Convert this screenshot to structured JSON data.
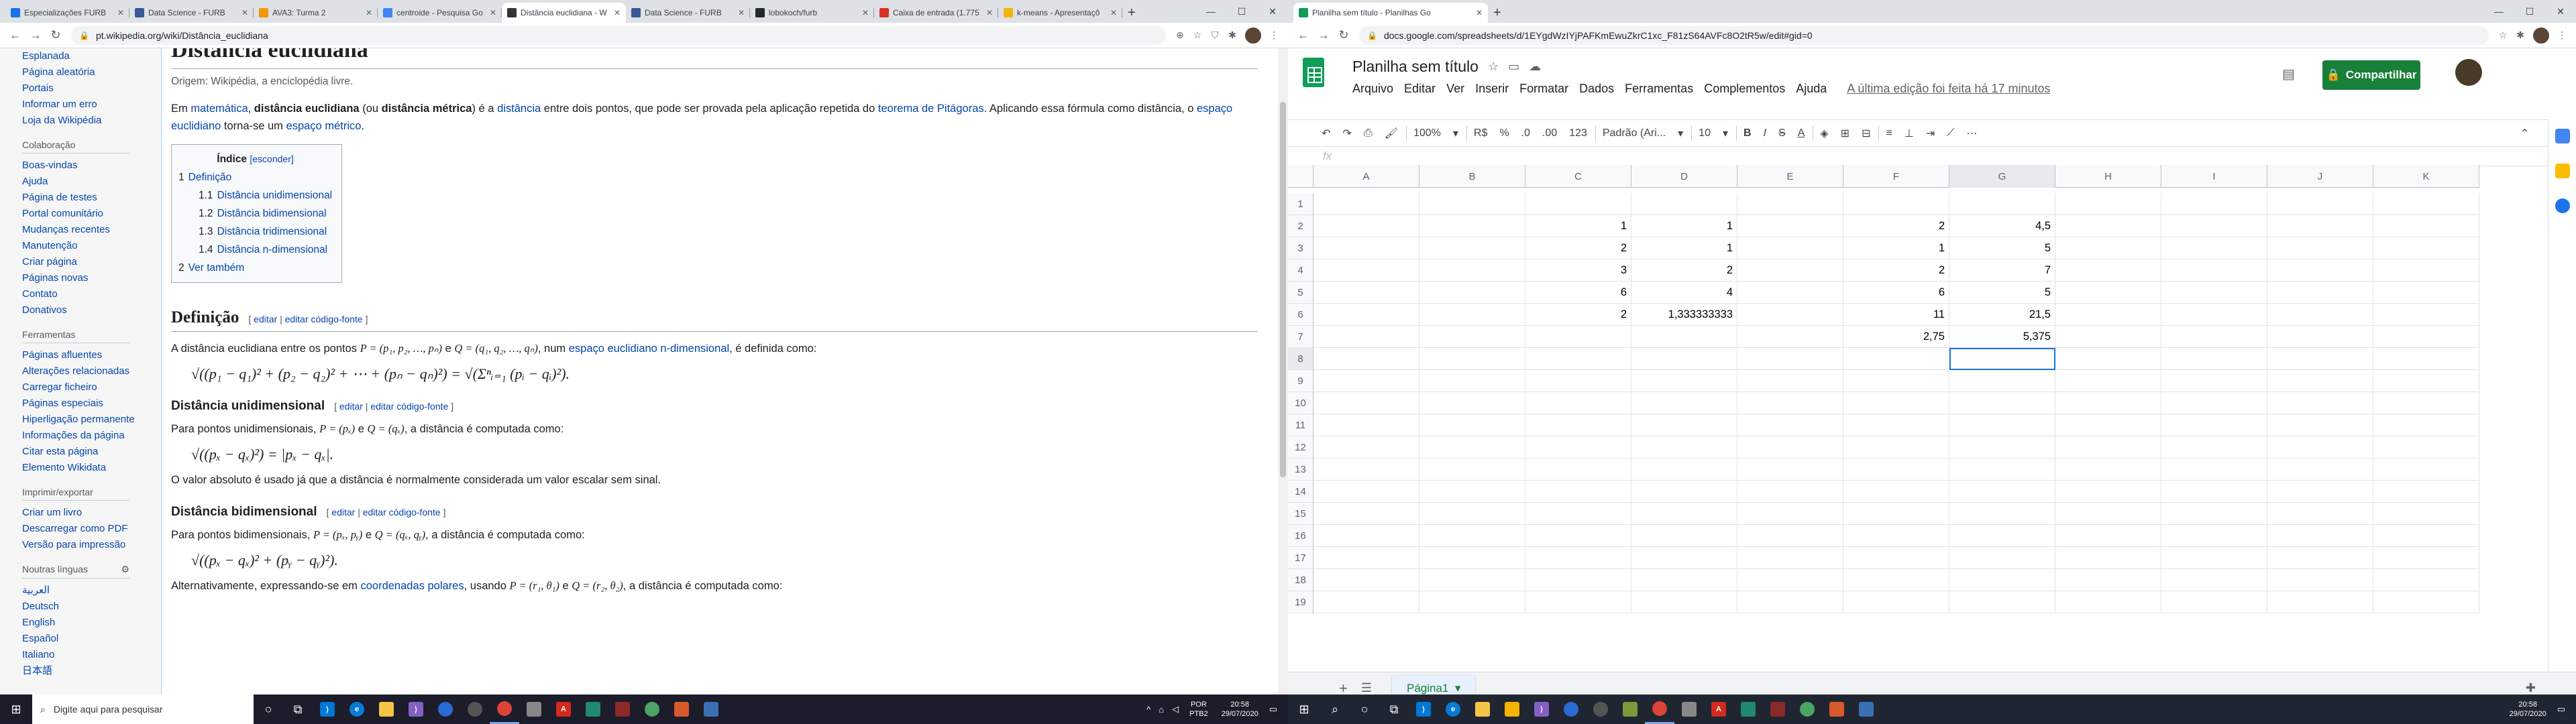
{
  "left": {
    "tabs": [
      {
        "title": "Especializações FURB",
        "color": "#1a73e8"
      },
      {
        "title": "Data Science - FURB",
        "color": "#3b5998"
      },
      {
        "title": "AVA3: Turma 2",
        "color": "#f29900"
      },
      {
        "title": "centroide - Pesquisa Go",
        "color": "#4285f4"
      },
      {
        "title": "Distância euclidiana - W",
        "color": "#333333",
        "active": true
      },
      {
        "title": "Data Science - FURB",
        "color": "#3b5998"
      },
      {
        "title": "lobokoch/furb",
        "color": "#24292e"
      },
      {
        "title": "Caixa de entrada (1.775",
        "color": "#d93025"
      },
      {
        "title": "k-means - Apresentaçõ",
        "color": "#f4b400"
      }
    ],
    "url": "pt.wikipedia.org/wiki/Distância_euclidiana",
    "sidebar": {
      "top_links": [
        "Esplanada",
        "Página aleatória",
        "Portais",
        "Informar um erro",
        "Loja da Wikipédia"
      ],
      "sections": [
        {
          "title": "Colaboração",
          "links": [
            "Boas-vindas",
            "Ajuda",
            "Página de testes",
            "Portal comunitário",
            "Mudanças recentes",
            "Manutenção",
            "Criar página",
            "Páginas novas",
            "Contato",
            "Donativos"
          ]
        },
        {
          "title": "Ferramentas",
          "links": [
            "Páginas afluentes",
            "Alterações relacionadas",
            "Carregar ficheiro",
            "Páginas especiais",
            "Hiperligação permanente",
            "Informações da página",
            "Citar esta página",
            "Elemento Wikidata"
          ]
        },
        {
          "title": "Imprimir/exportar",
          "links": [
            "Criar um livro",
            "Descarregar como PDF",
            "Versão para impressão"
          ]
        },
        {
          "title": "Noutras línguas",
          "links": [
            "العربية",
            "Deutsch",
            "English",
            "Español",
            "Italiano",
            "日本語"
          ]
        }
      ]
    },
    "article": {
      "title": "Distância euclidiana",
      "origin": "Origem: Wikipédia, a enciclopédia livre.",
      "intro": {
        "a1": "Em ",
        "l1": "matemática",
        "a2": ", ",
        "b1": "distância euclidiana",
        "a3": " (ou ",
        "b2": "distância métrica",
        "a4": ") é a ",
        "l2": "distância",
        "a5": " entre dois pontos, que pode ser provada pela aplicação repetida do ",
        "l3": "teorema de Pitágoras",
        "a6": ". Aplicando essa fórmula como distância, o ",
        "l4": "espaço euclidiano",
        "a7": " torna-se um ",
        "l5": "espaço métrico",
        "a8": "."
      },
      "toc": {
        "title": "Índice",
        "toggle": "[esconder]",
        "items": [
          {
            "num": "1",
            "label": "Definição",
            "level": 1
          },
          {
            "num": "1.1",
            "label": "Distância unidimensional",
            "level": 2
          },
          {
            "num": "1.2",
            "label": "Distância bidimensional",
            "level": 2
          },
          {
            "num": "1.3",
            "label": "Distância tridimensional",
            "level": 2
          },
          {
            "num": "1.4",
            "label": "Distância n-dimensional",
            "level": 2
          },
          {
            "num": "2",
            "label": "Ver também",
            "level": 1
          }
        ]
      },
      "edit_links": {
        "open": "[ ",
        "edit": "editar",
        "sep": " | ",
        "edit_source": "editar código-fonte",
        "close": " ]"
      },
      "definition": {
        "heading": "Definição",
        "text1": "A distância euclidiana entre os pontos ",
        "p": "P = (p₁, p₂, …, pₙ)",
        "and": " e ",
        "q": "Q = (q₁, q₂, …, qₙ)",
        "text2": ", num ",
        "link": "espaço euclidiano n-dimensional",
        "text3": ", é definida como:",
        "formula": "√((p₁ − q₁)² + (p₂ − q₂)² + ⋯ + (pₙ − qₙ)²) = √(Σⁿᵢ₌₁ (pᵢ − qᵢ)²)."
      },
      "uni": {
        "heading": "Distância unidimensional",
        "text1": "Para pontos unidimensionais, ",
        "p": "P = (pₓ)",
        "and": " e ",
        "q": "Q = (qₓ)",
        "text2": ", a distância é computada como:",
        "formula": "√((pₓ − qₓ)²) = |pₓ − qₓ|.",
        "note": "O valor absoluto é usado já que a distância é normalmente considerada um valor escalar sem sinal."
      },
      "bi": {
        "heading": "Distância bidimensional",
        "text1": "Para pontos bidimensionais, ",
        "p": "P = (pₓ, pᵧ)",
        "and": " e ",
        "q": "Q = (qₓ, qᵧ)",
        "text2": ", a distância é computada como:",
        "formula": "√((pₓ − qₓ)² + (pᵧ − qᵧ)²).",
        "alt1": "Alternativamente, expressando-se em ",
        "alt_link": "coordenadas polares",
        "alt2": ", usando ",
        "alt_p": "P = (r₁, θ₁)",
        "alt_and": " e ",
        "alt_q": "Q = (r₂, θ₂)",
        "alt3": ", a distância é computada como:"
      }
    },
    "taskbar": {
      "search_placeholder": "Digite aqui para pesquisar",
      "lang": "POR",
      "lang2": "PTB2",
      "time": "20:58",
      "date": "29/07/2020"
    }
  },
  "right": {
    "tabs": [
      {
        "title": "Planilha sem título - Planilhas Go",
        "color": "#0f9d58",
        "active": true
      }
    ],
    "url": "docs.google.com/spreadsheets/d/1EYgdWzIYjPAFKmEwuZkrC1xc_F81zS64AVFc8O2tR5w/edit#gid=0",
    "doc_title": "Planilha sem título",
    "menu": [
      "Arquivo",
      "Editar",
      "Ver",
      "Inserir",
      "Formatar",
      "Dados",
      "Ferramentas",
      "Complementos",
      "Ajuda"
    ],
    "last_edit": "A última edição foi feita há 17 minutos",
    "share_label": "Compartilhar",
    "toolbar": {
      "zoom": "100%",
      "currency": "R$",
      "percent": "%",
      "dec_less": ".0",
      "dec_more": ".00",
      "format": "123",
      "font": "Padrão (Ari...",
      "size": "10"
    },
    "fx": "fx",
    "columns": [
      "A",
      "B",
      "C",
      "D",
      "E",
      "F",
      "G",
      "H",
      "I",
      "J",
      "K"
    ],
    "rows": [
      [
        "",
        "",
        "",
        "",
        "",
        "",
        "",
        "",
        "",
        "",
        ""
      ],
      [
        "",
        "",
        "1",
        "1",
        "",
        "2",
        "4,5",
        "",
        "",
        "",
        ""
      ],
      [
        "",
        "",
        "2",
        "1",
        "",
        "1",
        "5",
        "",
        "",
        "",
        ""
      ],
      [
        "",
        "",
        "3",
        "2",
        "",
        "2",
        "7",
        "",
        "",
        "",
        ""
      ],
      [
        "",
        "",
        "6",
        "4",
        "",
        "6",
        "5",
        "",
        "",
        "",
        ""
      ],
      [
        "",
        "",
        "2",
        "1,333333333",
        "",
        "11",
        "21,5",
        "",
        "",
        "",
        ""
      ],
      [
        "",
        "",
        "",
        "",
        "",
        "2,75",
        "5,375",
        "",
        "",
        "",
        ""
      ],
      [
        "",
        "",
        "",
        "",
        "",
        "",
        "",
        "",
        "",
        "",
        ""
      ],
      [
        "",
        "",
        "",
        "",
        "",
        "",
        "",
        "",
        "",
        "",
        ""
      ],
      [
        "",
        "",
        "",
        "",
        "",
        "",
        "",
        "",
        "",
        "",
        ""
      ],
      [
        "",
        "",
        "",
        "",
        "",
        "",
        "",
        "",
        "",
        "",
        ""
      ],
      [
        "",
        "",
        "",
        "",
        "",
        "",
        "",
        "",
        "",
        "",
        ""
      ],
      [
        "",
        "",
        "",
        "",
        "",
        "",
        "",
        "",
        "",
        "",
        ""
      ],
      [
        "",
        "",
        "",
        "",
        "",
        "",
        "",
        "",
        "",
        "",
        ""
      ],
      [
        "",
        "",
        "",
        "",
        "",
        "",
        "",
        "",
        "",
        "",
        ""
      ],
      [
        "",
        "",
        "",
        "",
        "",
        "",
        "",
        "",
        "",
        "",
        ""
      ],
      [
        "",
        "",
        "",
        "",
        "",
        "",
        "",
        "",
        "",
        "",
        ""
      ],
      [
        "",
        "",
        "",
        "",
        "",
        "",
        "",
        "",
        "",
        "",
        ""
      ],
      [
        "",
        "",
        "",
        "",
        "",
        "",
        "",
        "",
        "",
        "",
        ""
      ]
    ],
    "row_numbers": [
      "1",
      "2",
      "3",
      "4",
      "5",
      "6",
      "7",
      "8",
      "9",
      "10",
      "11",
      "12",
      "13",
      "14",
      "15",
      "16",
      "17",
      "18",
      "19"
    ],
    "selected_cell": "G8",
    "sheet_tab": "Página1",
    "taskbar": {
      "time": "20:58",
      "date": "29/07/2020"
    }
  }
}
